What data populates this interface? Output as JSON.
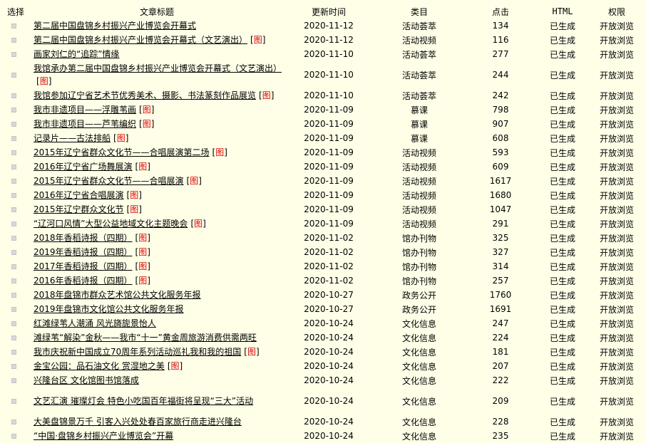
{
  "columns": {
    "select": "选择",
    "title": "文章标题",
    "updated": "更新时间",
    "category": "类目",
    "clicks": "点击",
    "html": "HTML",
    "permission": "权限"
  },
  "tag_text": "图",
  "rows": [
    {
      "title": "第二届中国盘锦乡村振兴产业博览会开幕式",
      "img": false,
      "date": "2020-11-12",
      "category": "活动荟萃",
      "clicks": "134",
      "html": "已生成",
      "perm": "开放浏览"
    },
    {
      "title": "第二届中国盘锦乡村振兴产业博览会开幕式（文艺演出）",
      "img": true,
      "date": "2020-11-12",
      "category": "活动视频",
      "clicks": "116",
      "html": "已生成",
      "perm": "开放浏览"
    },
    {
      "title": "画家刘仁的“追踪”情缘",
      "img": false,
      "date": "2020-11-10",
      "category": "活动荟萃",
      "clicks": "277",
      "html": "已生成",
      "perm": "开放浏览"
    },
    {
      "title": "我馆承办第二届中国盘锦乡村振兴产业博览会开幕式（文艺演出）",
      "img": true,
      "tall": true,
      "date": "2020-11-10",
      "category": "活动荟萃",
      "clicks": "244",
      "html": "已生成",
      "perm": "开放浏览"
    },
    {
      "title": "我馆参加辽宁省艺术节优秀美术、摄影、书法篆刻作品展览",
      "img": true,
      "date": "2020-11-10",
      "category": "活动荟萃",
      "clicks": "242",
      "html": "已生成",
      "perm": "开放浏览"
    },
    {
      "title": "我市非遗项目——浮雕苇画",
      "img": true,
      "date": "2020-11-09",
      "category": "慕课",
      "clicks": "798",
      "html": "已生成",
      "perm": "开放浏览"
    },
    {
      "title": "我市非遗项目——芦苇编织",
      "img": true,
      "date": "2020-11-09",
      "category": "慕课",
      "clicks": "907",
      "html": "已生成",
      "perm": "开放浏览"
    },
    {
      "title": "记录片——古法排船",
      "img": true,
      "date": "2020-11-09",
      "category": "慕课",
      "clicks": "608",
      "html": "已生成",
      "perm": "开放浏览"
    },
    {
      "title": "2015年辽宁省群众文化节——合唱展演第二场",
      "img": true,
      "date": "2020-11-09",
      "category": "活动视频",
      "clicks": "593",
      "html": "已生成",
      "perm": "开放浏览"
    },
    {
      "title": "2016年辽宁省广场舞展演",
      "img": true,
      "date": "2020-11-09",
      "category": "活动视频",
      "clicks": "609",
      "html": "已生成",
      "perm": "开放浏览"
    },
    {
      "title": "2015年辽宁省群众文化节——合唱展演",
      "img": true,
      "date": "2020-11-09",
      "category": "活动视频",
      "clicks": "1617",
      "html": "已生成",
      "perm": "开放浏览"
    },
    {
      "title": "2016年辽宁省合唱展演",
      "img": true,
      "date": "2020-11-09",
      "category": "活动视频",
      "clicks": "1680",
      "html": "已生成",
      "perm": "开放浏览"
    },
    {
      "title": "2015年辽宁群众文化节",
      "img": true,
      "date": "2020-11-09",
      "category": "活动视频",
      "clicks": "1047",
      "html": "已生成",
      "perm": "开放浏览"
    },
    {
      "title": "“辽河口风情”大型公益地域文化主题晚会",
      "img": true,
      "date": "2020-11-09",
      "category": "活动视频",
      "clicks": "291",
      "html": "已生成",
      "perm": "开放浏览"
    },
    {
      "title": "2018年香稻诗报（四期）",
      "img": true,
      "date": "2020-11-02",
      "category": "馆办刊物",
      "clicks": "325",
      "html": "已生成",
      "perm": "开放浏览"
    },
    {
      "title": "2019年香稻诗报（四期）",
      "img": true,
      "date": "2020-11-02",
      "category": "馆办刊物",
      "clicks": "327",
      "html": "已生成",
      "perm": "开放浏览"
    },
    {
      "title": "2017年香稻诗报（四期）",
      "img": true,
      "date": "2020-11-02",
      "category": "馆办刊物",
      "clicks": "314",
      "html": "已生成",
      "perm": "开放浏览"
    },
    {
      "title": "2016年香稻诗报（四期）",
      "img": true,
      "date": "2020-11-02",
      "category": "馆办刊物",
      "clicks": "257",
      "html": "已生成",
      "perm": "开放浏览"
    },
    {
      "title": "2018年盘锦市群众艺术馆公共文化服务年报",
      "img": false,
      "date": "2020-10-27",
      "category": "政务公开",
      "clicks": "1760",
      "html": "已生成",
      "perm": "开放浏览"
    },
    {
      "title": "2019年盘锦市文化馆公共文化服务年报",
      "img": false,
      "date": "2020-10-27",
      "category": "政务公开",
      "clicks": "1691",
      "html": "已生成",
      "perm": "开放浏览"
    },
    {
      "title": "红滩绿苇人潮涌 风光旖旎景怡人",
      "img": false,
      "date": "2020-10-24",
      "category": "文化信息",
      "clicks": "247",
      "html": "已生成",
      "perm": "开放浏览"
    },
    {
      "title": "滩绿苇“解染”金秋——我市“十一”黄金周旅游消费供需两旺",
      "img": false,
      "date": "2020-10-24",
      "category": "文化信息",
      "clicks": "224",
      "html": "已生成",
      "perm": "开放浏览"
    },
    {
      "title": "我市庆祝新中国成立70周年系列活动巡礼我和我的祖国",
      "img": true,
      "date": "2020-10-24",
      "category": "文化信息",
      "clicks": "181",
      "html": "已生成",
      "perm": "开放浏览"
    },
    {
      "title": "金宝公园：品石油文化 赏湿地之美",
      "img": true,
      "date": "2020-10-24",
      "category": "文化信息",
      "clicks": "207",
      "html": "已生成",
      "perm": "开放浏览"
    },
    {
      "title": "兴隆台区 文化馆图书馆落成",
      "img": false,
      "date": "2020-10-24",
      "category": "文化信息",
      "clicks": "222",
      "html": "已生成",
      "perm": "开放浏览"
    },
    {
      "title": "文艺汇演 璀璨灯会 特色小吃国百年福街将呈现“三大”活动",
      "img": false,
      "tall": true,
      "date": "2020-10-24",
      "category": "文化信息",
      "clicks": "209",
      "html": "已生成",
      "perm": "开放浏览"
    },
    {
      "title": "大美盘锦景万千 引客入兴处处春百家旅行商走进兴隆台",
      "img": false,
      "date": "2020-10-24",
      "category": "文化信息",
      "clicks": "228",
      "html": "已生成",
      "perm": "开放浏览"
    },
    {
      "title": "“中国·盘锦乡村振兴产业博览会”开幕",
      "img": false,
      "date": "2020-10-24",
      "category": "文化信息",
      "clicks": "235",
      "html": "已生成",
      "perm": "开放浏览"
    }
  ]
}
